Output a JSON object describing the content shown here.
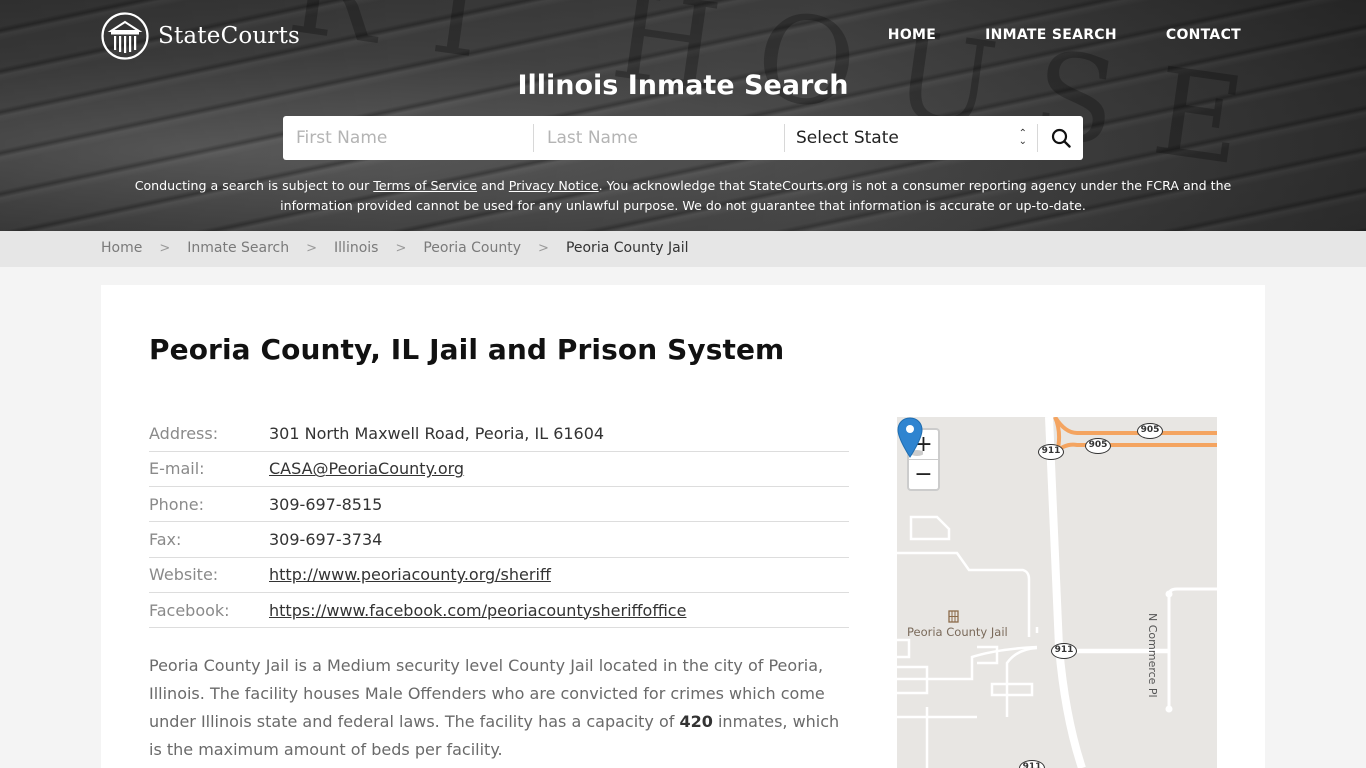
{
  "brand": {
    "name": "StateCourts"
  },
  "nav": {
    "home": "HOME",
    "inmate_search": "INMATE SEARCH",
    "contact": "CONTACT"
  },
  "hero": {
    "title": "Illinois Inmate Search",
    "background_letters": "RT HOUSE",
    "search": {
      "first_name_placeholder": "First Name",
      "last_name_placeholder": "Last Name",
      "state_selected": "Select State"
    },
    "disclaimer": {
      "part1": "Conducting a search is subject to our ",
      "terms_link": "Terms of Service",
      "part2": " and ",
      "privacy_link": "Privacy Notice",
      "part3": ". You acknowledge that StateCourts.org is not a consumer reporting agency under the FCRA and the information provided cannot be used for any unlawful purpose. We do not guarantee that information is accurate or up-to-date."
    }
  },
  "breadcrumb": {
    "items": [
      "Home",
      "Inmate Search",
      "Illinois",
      "Peoria County"
    ],
    "current": "Peoria County Jail",
    "separator": ">"
  },
  "page": {
    "title": "Peoria County, IL Jail and Prison System",
    "info": [
      {
        "label": "Address:",
        "value": "301 North Maxwell Road, Peoria, IL 61604",
        "link": false
      },
      {
        "label": "E-mail:",
        "value": "CASA@PeoriaCounty.org",
        "link": true
      },
      {
        "label": "Phone:",
        "value": "309-697-8515",
        "link": false
      },
      {
        "label": "Fax:",
        "value": "309-697-3734",
        "link": false
      },
      {
        "label": "Website:",
        "value": "http://www.peoriacounty.org/sheriff",
        "link": true
      },
      {
        "label": "Facebook:",
        "value": "https://www.facebook.com/peoriacountysheriffoffice",
        "link": true
      }
    ],
    "description": {
      "part1": "Peoria County Jail is a Medium security level County Jail located in the city of Peoria, Illinois. The facility houses Male Offenders who are convicted for crimes which come under Illinois state and federal laws. The facility has a capacity of ",
      "capacity": "420",
      "part2": " inmates, which is the maximum amount of beds per facility."
    }
  },
  "map": {
    "zoom_in": "+",
    "zoom_out": "−",
    "place_label": "Peoria County Jail",
    "street_label": "N Commerce Pl",
    "route_shields": [
      "911",
      "905",
      "905",
      "911",
      "911"
    ],
    "highway_color": "#f4a460"
  }
}
